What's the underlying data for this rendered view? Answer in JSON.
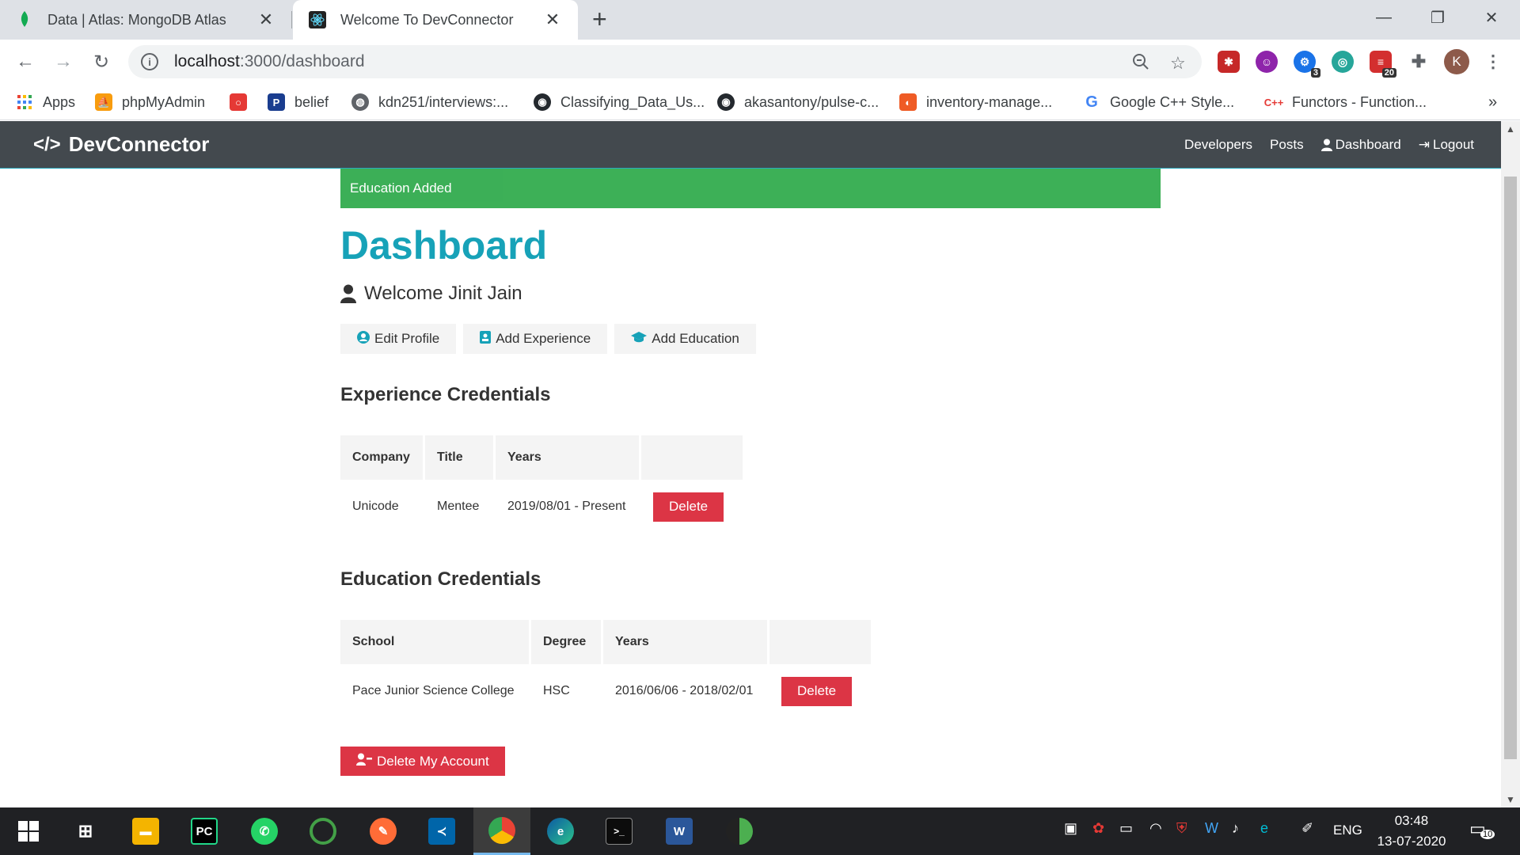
{
  "browser": {
    "tabs": [
      {
        "title": "Data | Atlas: MongoDB Atlas",
        "icon": "mongodb-leaf-icon",
        "active": false
      },
      {
        "title": "Welcome To DevConnector",
        "icon": "react-icon",
        "active": true
      }
    ],
    "url_host": "localhost",
    "url_path": ":3000/dashboard",
    "profile_initial": "K",
    "extension_badges": {
      "ext3": "3",
      "ext6": "20"
    },
    "bookmarks": [
      {
        "label": "Apps",
        "icon": "apps-grid-icon"
      },
      {
        "label": "phpMyAdmin",
        "icon": "phpmyadmin-icon"
      },
      {
        "label": "",
        "icon": "oracle-icon"
      },
      {
        "label": "belief",
        "icon": "p-icon"
      },
      {
        "label": "kdn251/interviews:...",
        "icon": "globe-icon"
      },
      {
        "label": "Classifying_Data_Us...",
        "icon": "github-icon"
      },
      {
        "label": "akasantony/pulse-c...",
        "icon": "github-icon"
      },
      {
        "label": "inventory-manage...",
        "icon": "postman-icon"
      },
      {
        "label": "Google C++ Style...",
        "icon": "google-icon"
      },
      {
        "label": "Functors - Function...",
        "icon": "cpp-icon"
      }
    ]
  },
  "app": {
    "brand": "DevConnector",
    "nav": {
      "developers": "Developers",
      "posts": "Posts",
      "dashboard": "Dashboard",
      "logout": "Logout"
    },
    "alert": "Education Added",
    "page_title": "Dashboard",
    "welcome": "Welcome Jinit Jain",
    "actions": {
      "edit_profile": "Edit Profile",
      "add_experience": "Add Experience",
      "add_education": "Add Education"
    },
    "experience": {
      "heading": "Experience Credentials",
      "columns": [
        "Company",
        "Title",
        "Years",
        ""
      ],
      "rows": [
        {
          "company": "Unicode",
          "title": "Mentee",
          "years": "2019/08/01 - Present",
          "action": "Delete"
        }
      ]
    },
    "education": {
      "heading": "Education Credentials",
      "columns": [
        "School",
        "Degree",
        "Years",
        ""
      ],
      "rows": [
        {
          "school": "Pace Junior Science College",
          "degree": "HSC",
          "years": "2016/06/06 - 2018/02/01",
          "action": "Delete"
        }
      ]
    },
    "delete_account": "Delete My Account"
  },
  "taskbar": {
    "language": "ENG",
    "time": "03:48",
    "date": "13-07-2020",
    "notifications": "10"
  },
  "colors": {
    "primary": "#17a2b8",
    "navbar": "#343a40",
    "success": "#28a745",
    "danger": "#dc3545",
    "light": "#f4f4f4"
  }
}
